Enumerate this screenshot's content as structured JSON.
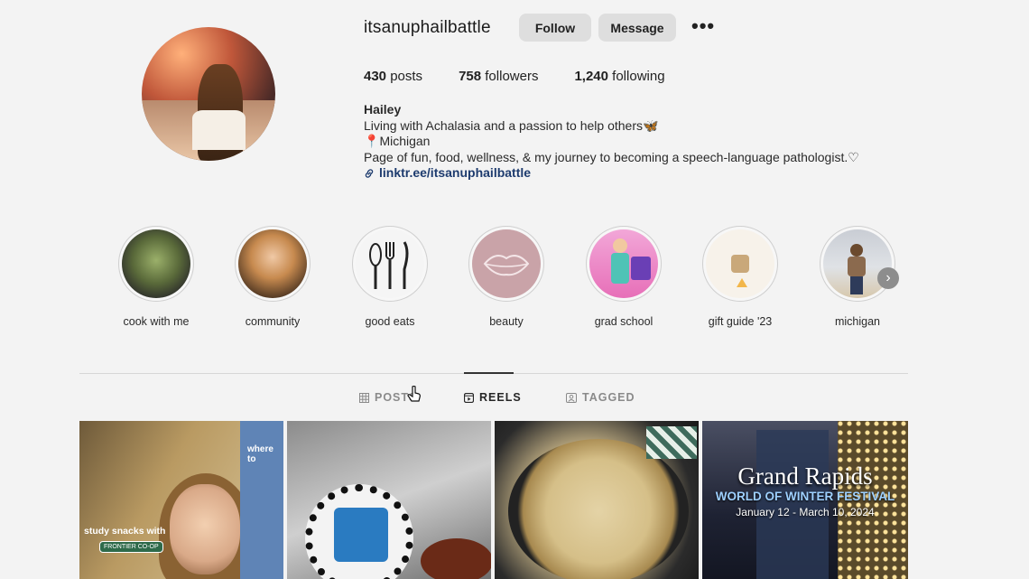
{
  "profile": {
    "username": "itsanuphailbattle",
    "follow_label": "Follow",
    "message_label": "Message",
    "more_label": "•••",
    "stats": {
      "posts_count": "430",
      "posts_label": "posts",
      "followers_count": "758",
      "followers_label": "followers",
      "following_count": "1,240",
      "following_label": "following"
    },
    "bio": {
      "name": "Hailey",
      "line1": "Living with Achalasia and a passion to help others",
      "line1_emoji": "🦋",
      "line2_emoji": "📍",
      "line2": "Michigan",
      "line3": "Page of fun, food, wellness, & my journey to becoming a speech-language pathologist.",
      "line3_emoji": "♡",
      "link": "linktr.ee/itsanuphailbattle"
    }
  },
  "highlights": [
    {
      "label": "cook with me",
      "icon": "food-bowl-image"
    },
    {
      "label": "community",
      "icon": "portrait-image"
    },
    {
      "label": "good eats",
      "icon": "utensils-icon"
    },
    {
      "label": "beauty",
      "icon": "lips-icon"
    },
    {
      "label": "grad school",
      "icon": "doll-image"
    },
    {
      "label": "gift guide '23",
      "icon": "gift-guide-image"
    },
    {
      "label": "michigan",
      "icon": "person-beach-image"
    }
  ],
  "tabs": [
    {
      "label": "POSTS",
      "icon": "grid-icon",
      "active": false
    },
    {
      "label": "REELS",
      "icon": "reels-icon",
      "active": true
    },
    {
      "label": "TAGGED",
      "icon": "tagged-icon",
      "active": false
    }
  ],
  "posts": [
    {
      "overlay_text": "study snacks with",
      "badge": "FRONTIER CO-OP",
      "sign_text": "where to"
    },
    {},
    {},
    {
      "title": "Grand Rapids",
      "subtitle": "WORLD OF WINTER FESTIVAL",
      "dates": "January 12 - March 10, 2024"
    }
  ],
  "colors": {
    "background": "#f3f3f3",
    "button_bg": "#dedede",
    "link": "#1d3b6e",
    "tab_inactive": "#8a8a8a",
    "tab_active": "#262626"
  }
}
